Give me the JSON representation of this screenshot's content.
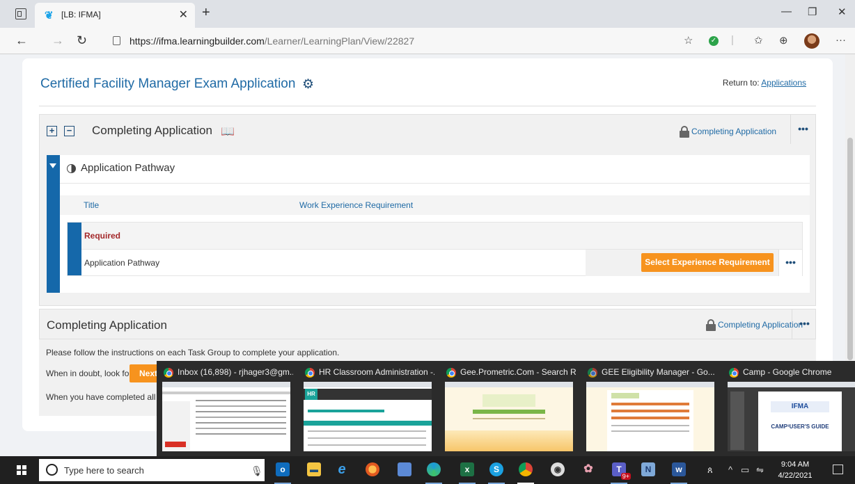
{
  "browser": {
    "tab_title": "[LB: IFMA]",
    "url_host": "https://ifma.learningbuilder.com",
    "url_path": "/Learner/LearningPlan/View/22827"
  },
  "page": {
    "title": "Certified Facility Manager Exam Application",
    "return_label": "Return to:",
    "return_link": "Applications"
  },
  "section1": {
    "title": "Completing Application",
    "status": "Completing Application",
    "pathway": {
      "title": "Application Pathway",
      "col_title": "Title",
      "col_requirement": "Work Experience Requirement",
      "required_label": "Required",
      "row_name": "Application Pathway",
      "action_label": "Select Experience Requirement"
    }
  },
  "section2": {
    "title": "Completing Application",
    "status": "Completing Application",
    "line1": "Please follow the instructions on each Task Group to complete your application.",
    "line2": "When in doubt, look for",
    "next_label": "Next",
    "line3": "When you have completed all yo"
  },
  "previews": [
    {
      "label": "Inbox (16,898) - rjhager3@gm..."
    },
    {
      "label": "HR Classroom Administration -..."
    },
    {
      "label": "Gee.Prometric.Com - Search Re..."
    },
    {
      "label": "GEE Eligibility Manager - Go..."
    },
    {
      "label": "Camp - Google Chrome"
    }
  ],
  "preview_texts": {
    "camp_logo": "IFMA",
    "camp_guide": "CAMP³USER'S GUIDE",
    "hr_logo": "HR"
  },
  "taskbar": {
    "search_placeholder": "Type here to search",
    "time": "9:04 AM",
    "date": "4/22/2021",
    "teams_badge": "9+"
  }
}
